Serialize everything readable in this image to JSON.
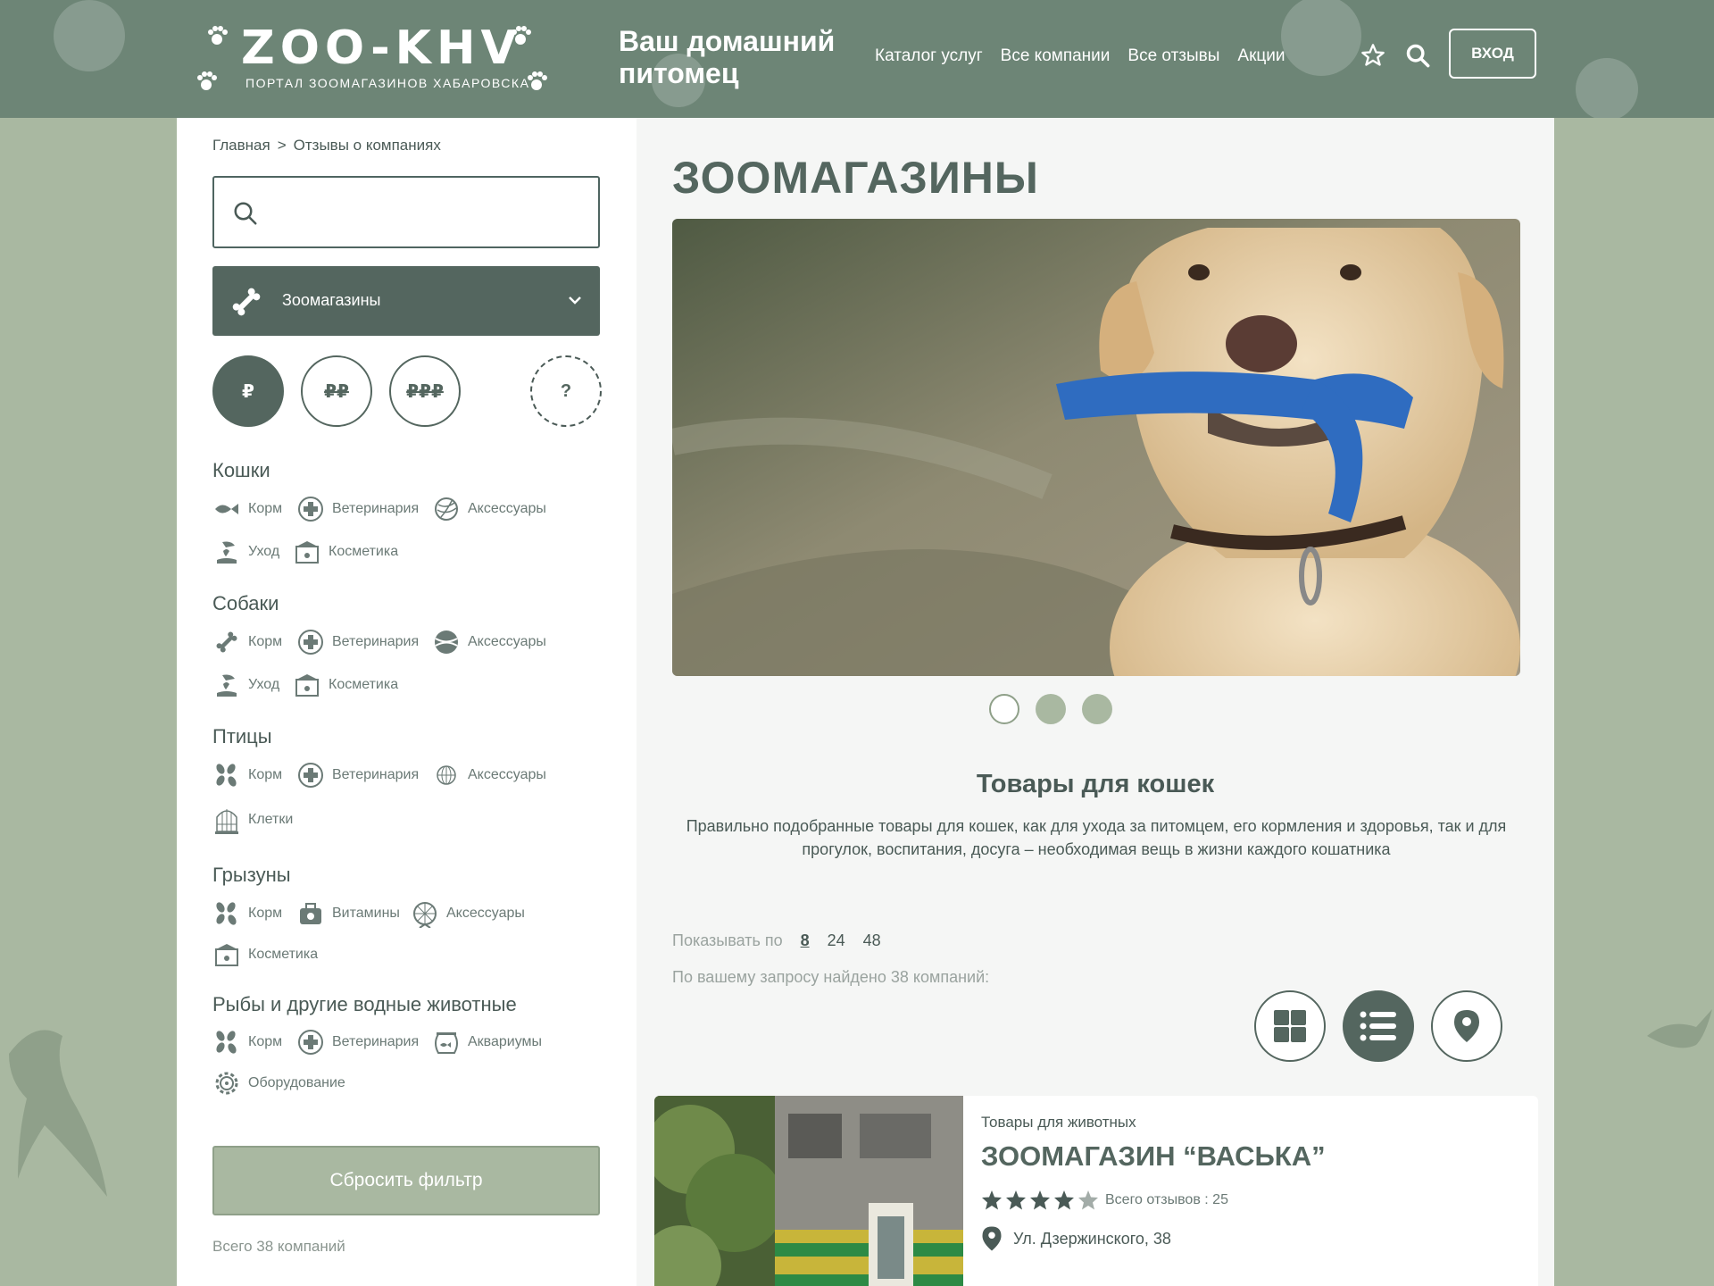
{
  "header": {
    "logo_title": "ZOO-KHV",
    "logo_subtitle": "ПОРТАЛ ЗООМАГАЗИНОВ ХАБАРОВСКА",
    "tagline": "Ваш домашний питомец",
    "nav": [
      "Каталог услуг",
      "Все компании",
      "Все отзывы",
      "Акции"
    ],
    "login_label": "ВХОД",
    "colors": {
      "header_bg": "#6d8576",
      "accent": "#54665f",
      "page_bg": "#a9b8a1"
    }
  },
  "breadcrumb": {
    "home": "Главная",
    "separator": ">",
    "current": "Отзывы о компаниях"
  },
  "search": {
    "placeholder": ""
  },
  "category": {
    "selected": "Зоомагазины"
  },
  "price_filters": [
    "₽",
    "₽₽",
    "₽₽₽",
    "?"
  ],
  "filter_groups": [
    {
      "title": "Кошки",
      "items": [
        {
          "label": "Корм",
          "icon": "fish-icon"
        },
        {
          "label": "Ветеринария",
          "icon": "medical-cross-icon"
        },
        {
          "label": "Аксессуары",
          "icon": "yarn-ball-icon"
        },
        {
          "label": "Уход",
          "icon": "care-hand-icon"
        },
        {
          "label": "Косметика",
          "icon": "cosmetics-box-icon"
        }
      ]
    },
    {
      "title": "Собаки",
      "items": [
        {
          "label": "Корм",
          "icon": "bone-icon"
        },
        {
          "label": "Ветеринария",
          "icon": "medical-cross-icon"
        },
        {
          "label": "Аксессуары",
          "icon": "tennis-ball-icon"
        },
        {
          "label": "Уход",
          "icon": "care-hand-icon"
        },
        {
          "label": "Косметика",
          "icon": "cosmetics-box-icon"
        }
      ]
    },
    {
      "title": "Птицы",
      "items": [
        {
          "label": "Корм",
          "icon": "seeds-icon"
        },
        {
          "label": "Ветеринария",
          "icon": "medical-cross-icon"
        },
        {
          "label": "Аксессуары",
          "icon": "bird-toy-icon"
        },
        {
          "label": "Клетки",
          "icon": "cage-icon"
        }
      ]
    },
    {
      "title": "Грызуны",
      "items": [
        {
          "label": "Корм",
          "icon": "seeds-icon"
        },
        {
          "label": "Витамины",
          "icon": "vitamins-icon"
        },
        {
          "label": "Аксессуары",
          "icon": "wheel-icon"
        },
        {
          "label": "Косметика",
          "icon": "cosmetics-box-icon"
        }
      ]
    },
    {
      "title": "Рыбы и другие водные животные",
      "items": [
        {
          "label": "Корм",
          "icon": "seeds-icon"
        },
        {
          "label": "Ветеринария",
          "icon": "medical-cross-icon"
        },
        {
          "label": "Аквариумы",
          "icon": "aquarium-icon"
        },
        {
          "label": "Оборудование",
          "icon": "gear-icon"
        }
      ]
    }
  ],
  "reset_label": "Сбросить фильтр",
  "total_label": "Всего 38 компаний",
  "main": {
    "title": "ЗООМАГАЗИНЫ",
    "section_title": "Товары для кошек",
    "section_desc": "Правильно подобранные товары для кошек, как для ухода за питомцем, его кормления и здоровья, так и для прогулок, воспитания, досуга – необходимая вещь в жизни каждого кошатника",
    "per_page_label": "Показывать по",
    "per_page_options": [
      "8",
      "24",
      "48"
    ],
    "found_text": "По вашему запросу найдено 38 компаний:"
  },
  "carousel": {
    "slides": 3,
    "active": 0
  },
  "card": {
    "category": "Товары для животных",
    "title": "ЗООМАГАЗИН “ВАСЬКА”",
    "rating": 4,
    "rating_max": 5,
    "reviews_text": "Всего отзывов : 25",
    "address": "Ул. Дзержинского, 38"
  }
}
